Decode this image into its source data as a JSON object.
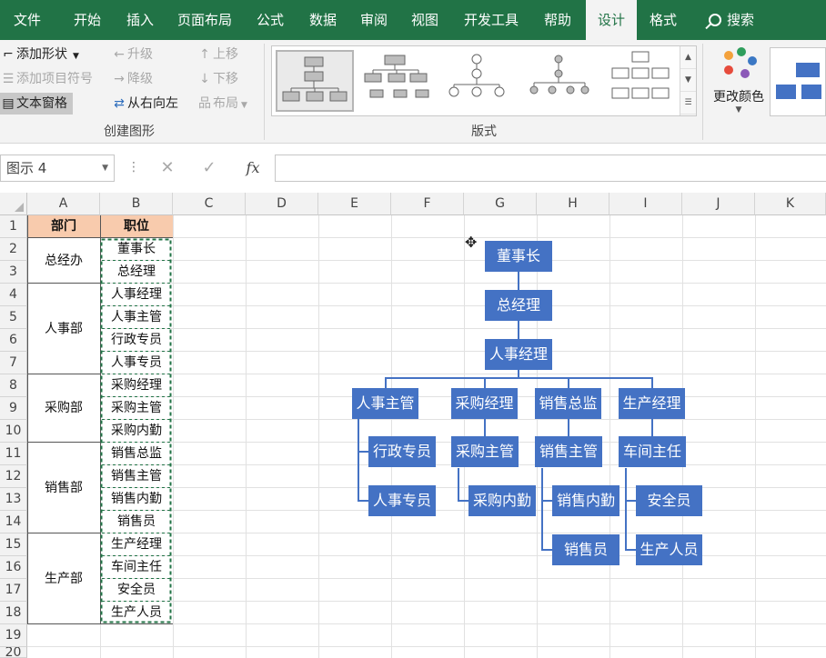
{
  "tabs": [
    {
      "label": "文件",
      "active": false
    },
    {
      "label": "开始",
      "active": false
    },
    {
      "label": "插入",
      "active": false
    },
    {
      "label": "页面布局",
      "active": false
    },
    {
      "label": "公式",
      "active": false
    },
    {
      "label": "数据",
      "active": false
    },
    {
      "label": "审阅",
      "active": false
    },
    {
      "label": "视图",
      "active": false
    },
    {
      "label": "开发工具",
      "active": false
    },
    {
      "label": "帮助",
      "active": false
    },
    {
      "label": "设计",
      "active": true
    },
    {
      "label": "格式",
      "active": false
    }
  ],
  "search_label": "搜索",
  "ribbon": {
    "create_group": {
      "add_shape": "添加形状",
      "add_bullet": "添加项目符号",
      "text_pane": "文本窗格",
      "promote": "升级",
      "demote": "降级",
      "right_to_left": "从右向左",
      "move_up": "上移",
      "move_down": "下移",
      "layout": "布局",
      "label": "创建图形"
    },
    "layouts_group": {
      "label": "版式"
    },
    "change_colors": "更改颜色",
    "colors": {
      "accent": "#4472c4",
      "tab_green": "#217346",
      "header_fill": "#f8cbad"
    }
  },
  "formula_bar": {
    "name_box": "图示 4",
    "fx": "fx",
    "value": ""
  },
  "sheet": {
    "columns": [
      "A",
      "B",
      "C",
      "D",
      "E",
      "F",
      "G",
      "H",
      "I",
      "J",
      "K"
    ],
    "rows": [
      "1",
      "2",
      "3",
      "4",
      "5",
      "6",
      "7",
      "8",
      "9",
      "10",
      "11",
      "12",
      "13",
      "14",
      "15",
      "16",
      "17",
      "18",
      "19",
      "20"
    ],
    "header": {
      "dept": "部门",
      "position": "职位"
    },
    "departments": [
      "总经办",
      "人事部",
      "采购部",
      "销售部",
      "生产部"
    ],
    "positions": [
      "董事长",
      "总经理",
      "人事经理",
      "人事主管",
      "行政专员",
      "人事专员",
      "采购经理",
      "采购主管",
      "采购内勤",
      "销售总监",
      "销售主管",
      "销售内勤",
      "销售员",
      "生产经理",
      "车间主任",
      "安全员",
      "生产人员"
    ]
  },
  "org_chart": {
    "chairman": "董事长",
    "general_manager": "总经理",
    "hr_manager": "人事经理",
    "hr_supervisor": "人事主管",
    "admin_specialist": "行政专员",
    "hr_specialist": "人事专员",
    "purchasing_manager": "采购经理",
    "purchasing_supervisor": "采购主管",
    "purchasing_clerk": "采购内勤",
    "sales_director": "销售总监",
    "sales_supervisor": "销售主管",
    "sales_clerk": "销售内勤",
    "salesperson": "销售员",
    "production_manager": "生产经理",
    "workshop_director": "车间主任",
    "safety_officer": "安全员",
    "production_staff": "生产人员"
  }
}
